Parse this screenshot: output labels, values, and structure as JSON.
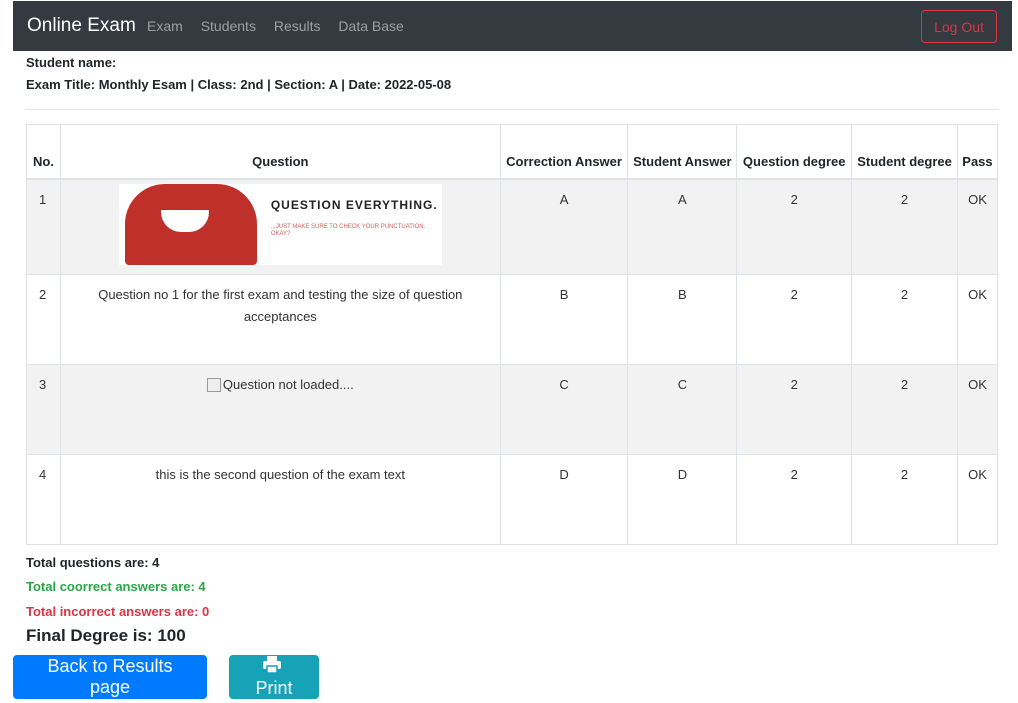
{
  "navbar": {
    "brand": "Online Exam",
    "links": [
      "Exam",
      "Students",
      "Results",
      "Data Base"
    ],
    "logout_label": "Log Out"
  },
  "info": {
    "student_line": "Student name:",
    "exam_line": "Exam Title: Monthly Esam | Class: 2nd | Section: A | Date: 2022-05-08"
  },
  "table": {
    "headers": {
      "no": "No.",
      "question": "Question",
      "correction": "Correction Answer",
      "student_answer": "Student Answer",
      "question_degree": "Question degree",
      "student_degree": "Student degree",
      "pass": "Pass"
    },
    "rows": [
      {
        "no": "1",
        "question": "",
        "question_image": {
          "title": "QUESTION EVERYTHING.",
          "subtitle": "...JUST MAKE SURE TO CHECK YOUR PUNCTUATION. OKAY?"
        },
        "correction": "A",
        "student_answer": "A",
        "question_degree": "2",
        "student_degree": "2",
        "pass": "OK"
      },
      {
        "no": "2",
        "question": "Question no 1 for the first exam and testing the size of question acceptances",
        "correction": "B",
        "student_answer": "B",
        "question_degree": "2",
        "student_degree": "2",
        "pass": "OK"
      },
      {
        "no": "3",
        "question": "Question not loaded....",
        "correction": "C",
        "student_answer": "C",
        "question_degree": "2",
        "student_degree": "2",
        "pass": "OK"
      },
      {
        "no": "4",
        "question": "this is the second question of the exam text",
        "correction": "D",
        "student_answer": "D",
        "question_degree": "2",
        "student_degree": "2",
        "pass": "OK"
      }
    ]
  },
  "summary": {
    "total": "Total questions are: 4",
    "correct": "Total coorrect answers are: 4",
    "incorrect": "Total incorrect answers are: 0",
    "final": "Final Degree is: 100"
  },
  "buttons": {
    "back": "Back to Results page",
    "print": "Print"
  },
  "colors": {
    "navbar_bg": "#343a40",
    "correct": "#28a745",
    "incorrect": "#dc3545",
    "primary": "#007bff",
    "info": "#17a2b8"
  }
}
